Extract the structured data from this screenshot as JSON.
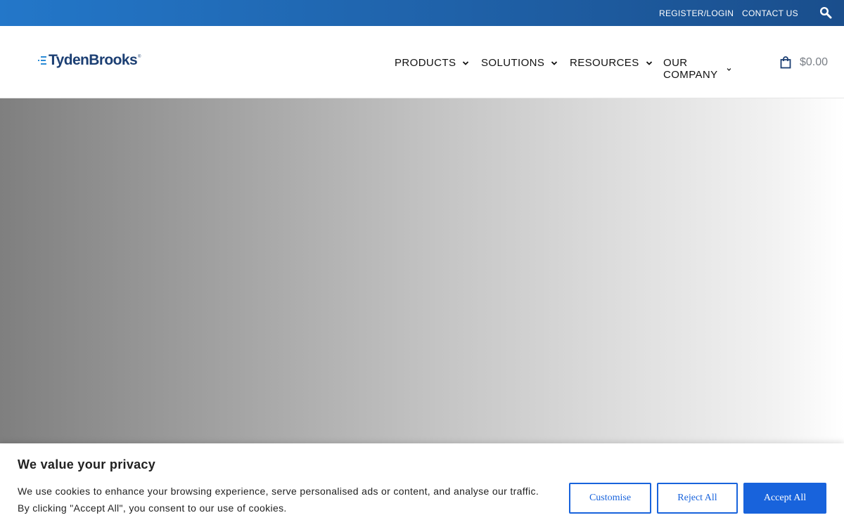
{
  "topbar": {
    "register_label": "REGISTER/LOGIN",
    "contact_label": "CONTACT US",
    "search_icon": "search-icon"
  },
  "header": {
    "logo_text": "TydenBrooks",
    "logo_reg": "®",
    "nav": [
      {
        "label": "PRODUCTS",
        "icon": "chevron-down-icon"
      },
      {
        "label": "SOLUTIONS",
        "icon": "chevron-down-icon"
      },
      {
        "label": "RESOURCES",
        "icon": "chevron-down-icon"
      },
      {
        "label": "OUR COMPANY",
        "icon": "chevron-down-icon"
      }
    ],
    "cart_icon": "shopping-bag-icon",
    "cart_total": "$0.00"
  },
  "cookie": {
    "title": "We value your privacy",
    "text_line1": "We use cookies to enhance your browsing experience, serve personalised ads or content, and analyse our traffic.",
    "text_line2": "By clicking \"Accept All\", you consent to our use of cookies.",
    "customise_label": "Customise",
    "reject_label": "Reject All",
    "accept_label": "Accept All"
  },
  "colors": {
    "brand_navy": "#1c3f73",
    "topbar_blue": "#1f61a8",
    "accent_blue": "#1863dc"
  }
}
